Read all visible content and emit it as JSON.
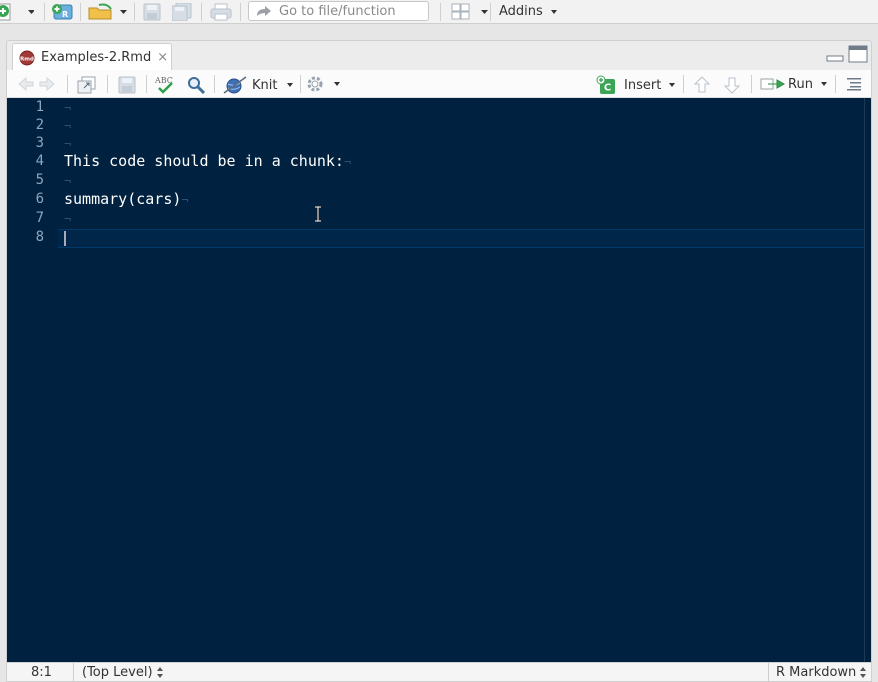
{
  "main_toolbar": {
    "goto_placeholder": "Go to file/function",
    "addins_label": "Addins"
  },
  "editor": {
    "tab_title": "Examples-2.Rmd",
    "tab_close": "×",
    "toolbar": {
      "spellcheck_label": "ABC",
      "knit_label": "Knit",
      "insert_label": "Insert",
      "insert_badge": "C",
      "run_label": "Run"
    },
    "lines": [
      {
        "num": "1",
        "text": "",
        "pilcrow": "¬"
      },
      {
        "num": "2",
        "text": "",
        "pilcrow": "¬"
      },
      {
        "num": "3",
        "text": "",
        "pilcrow": "¬"
      },
      {
        "num": "4",
        "text": "This code should be in a chunk:",
        "pilcrow": "¬"
      },
      {
        "num": "5",
        "text": "",
        "pilcrow": "¬"
      },
      {
        "num": "6",
        "text": "summary(cars)",
        "pilcrow": "¬"
      },
      {
        "num": "7",
        "text": "",
        "pilcrow": "¬"
      },
      {
        "num": "8",
        "text": "",
        "pilcrow": ""
      }
    ]
  },
  "status_bar": {
    "position": "8:1",
    "scope": "(Top Level)",
    "file_type": "R Markdown"
  },
  "colors": {
    "editor_background": "#002240",
    "code_text": "#ffffff",
    "line_number": "#8da6bf",
    "whitespace_marker": "#2d4f70"
  }
}
